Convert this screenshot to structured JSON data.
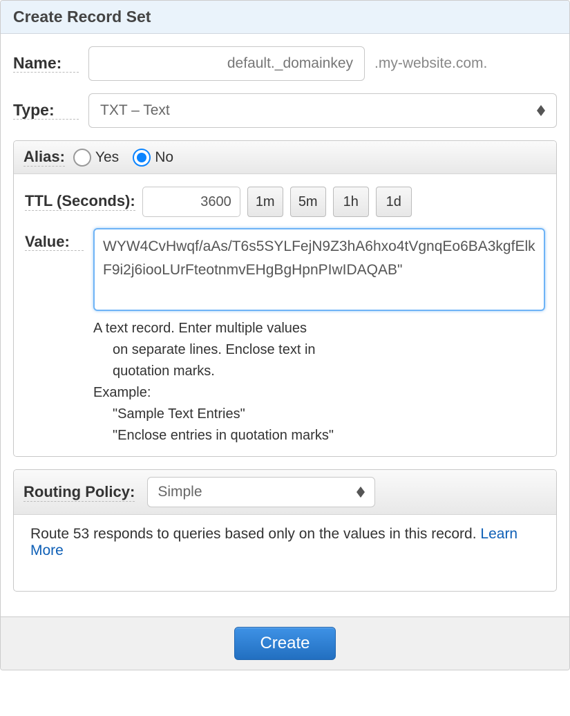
{
  "header": {
    "title": "Create Record Set"
  },
  "name": {
    "label": "Name:",
    "value": "default._domainkey",
    "suffix": ".my-website.com."
  },
  "type": {
    "label": "Type:",
    "selected": "TXT – Text"
  },
  "alias": {
    "label": "Alias:",
    "options": {
      "yes": "Yes",
      "no": "No"
    },
    "selected": "no"
  },
  "ttl": {
    "label": "TTL (Seconds):",
    "value": "3600",
    "quick": [
      "1m",
      "5m",
      "1h",
      "1d"
    ]
  },
  "value": {
    "label": "Value:",
    "text": "WYW4CvHwqf/aAs/T6s5SYLFejN9Z3hA6hxo4tVgnqEo6BA3kgfElkF9i2j6iooLUrFteotnmvEHgBgHpnPIwIDAQAB\"",
    "help": {
      "line1": "A text record. Enter multiple values",
      "line2": "on separate lines. Enclose text in",
      "line3": "quotation marks.",
      "example_label": "Example:",
      "ex1": "\"Sample Text Entries\"",
      "ex2": "\"Enclose entries in quotation marks\""
    }
  },
  "routing": {
    "label": "Routing Policy:",
    "selected": "Simple",
    "description": "Route 53 responds to queries based only on the values in this record.  ",
    "learn_more": "Learn More"
  },
  "footer": {
    "create": "Create"
  }
}
